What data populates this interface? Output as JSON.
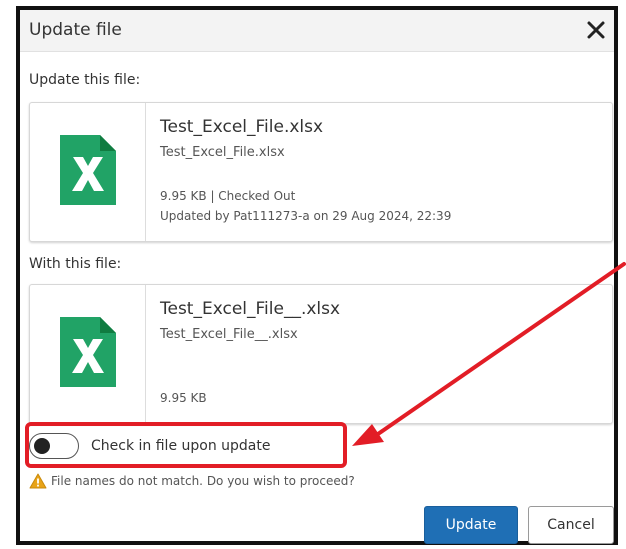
{
  "dialog": {
    "title": "Update file",
    "close_icon": "close-icon"
  },
  "current_file": {
    "section_label": "Update this file:",
    "name": "Test_Excel_File.xlsx",
    "subname": "Test_Excel_File.xlsx",
    "size_status": "9.95 KB | Checked Out",
    "updated": "Updated by Pat111273-a on 29 Aug 2024, 22:39",
    "icon": "excel-file-icon"
  },
  "new_file": {
    "section_label": "With this file:",
    "name": "Test_Excel_File__.xlsx",
    "subname": "Test_Excel_File__.xlsx",
    "size": "9.95 KB",
    "icon": "excel-file-icon"
  },
  "checkin_toggle": {
    "label": "Check in file upon update",
    "state": "off"
  },
  "warning": {
    "text": "File names do not match. Do you wish to proceed?",
    "icon": "warning-icon"
  },
  "buttons": {
    "update_label": "Update",
    "cancel_label": "Cancel"
  },
  "colors": {
    "primary": "#1f6fb5",
    "excel_green": "#21a366",
    "annotation_red": "#e21d26",
    "warning_orange": "#e8a317"
  }
}
